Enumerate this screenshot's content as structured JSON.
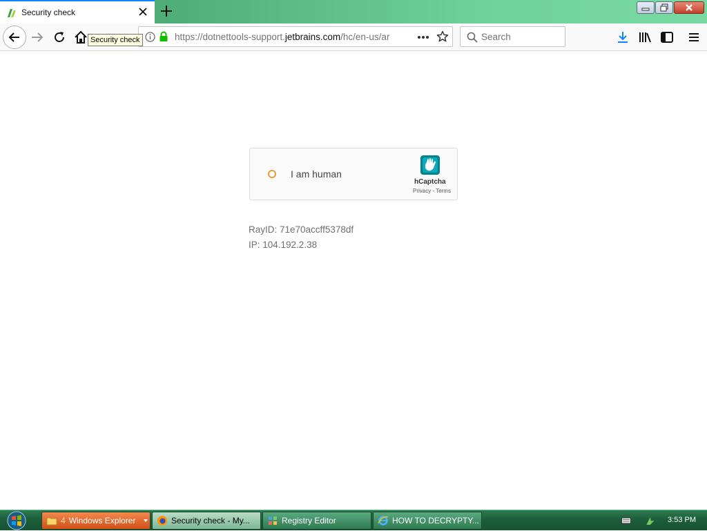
{
  "window": {
    "tab_title": "Security check",
    "tooltip": "Security check",
    "url_prefix": "https://dotnettools-support.",
    "url_host": "jetbrains.com",
    "url_suffix": "/hc/en-us/ar",
    "search_placeholder": "Search"
  },
  "page": {
    "captcha_label": "I am human",
    "captcha_brand": "hCaptcha",
    "captcha_links": "Privacy - Terms",
    "ray_id": "RayID: 71e70accff5378df",
    "ip": "IP: 104.192.2.38"
  },
  "taskbar": {
    "explorer_count": "4",
    "explorer_label": "Windows Explorer",
    "firefox_label": "Security check - My...",
    "regedit_label": "Registry Editor",
    "ie_label": "HOW TO DECRYPTY...",
    "clock": "3:53 PM"
  },
  "colors": {
    "accent": "#0a84ff",
    "taskbar": "#1c5e3a",
    "secure_lock": "#12bc00",
    "hcaptcha": "#00838f"
  }
}
